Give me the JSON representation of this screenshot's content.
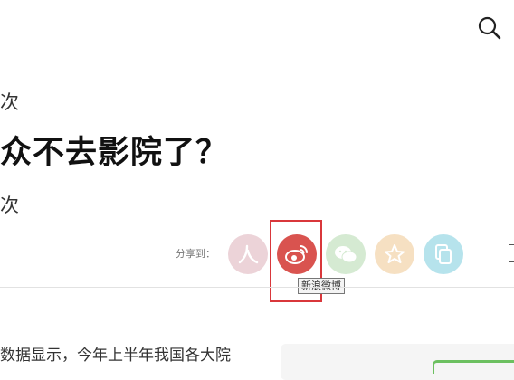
{
  "header": {
    "search_icon": "search-icon"
  },
  "article": {
    "meta_top": "次",
    "title": "众不去影院了？",
    "meta_bottom": "次",
    "paragraph": "数据显示，今年上半年我国各大院"
  },
  "share": {
    "label": "分享到：",
    "buttons": [
      {
        "name": "renren",
        "icon": "renren-icon",
        "color": "#ecd3d8"
      },
      {
        "name": "weibo",
        "icon": "weibo-icon",
        "color": "#d9534f"
      },
      {
        "name": "wechat",
        "icon": "wechat-icon",
        "color": "#d5ead2"
      },
      {
        "name": "qzone",
        "icon": "qzone-star-icon",
        "color": "#f6e0c2"
      },
      {
        "name": "copy",
        "icon": "copy-icon",
        "color": "#b6e3ec"
      }
    ],
    "tooltip": "新浪微博"
  },
  "colors": {
    "highlight": "#d9373b",
    "accent_green": "#6cc060"
  }
}
